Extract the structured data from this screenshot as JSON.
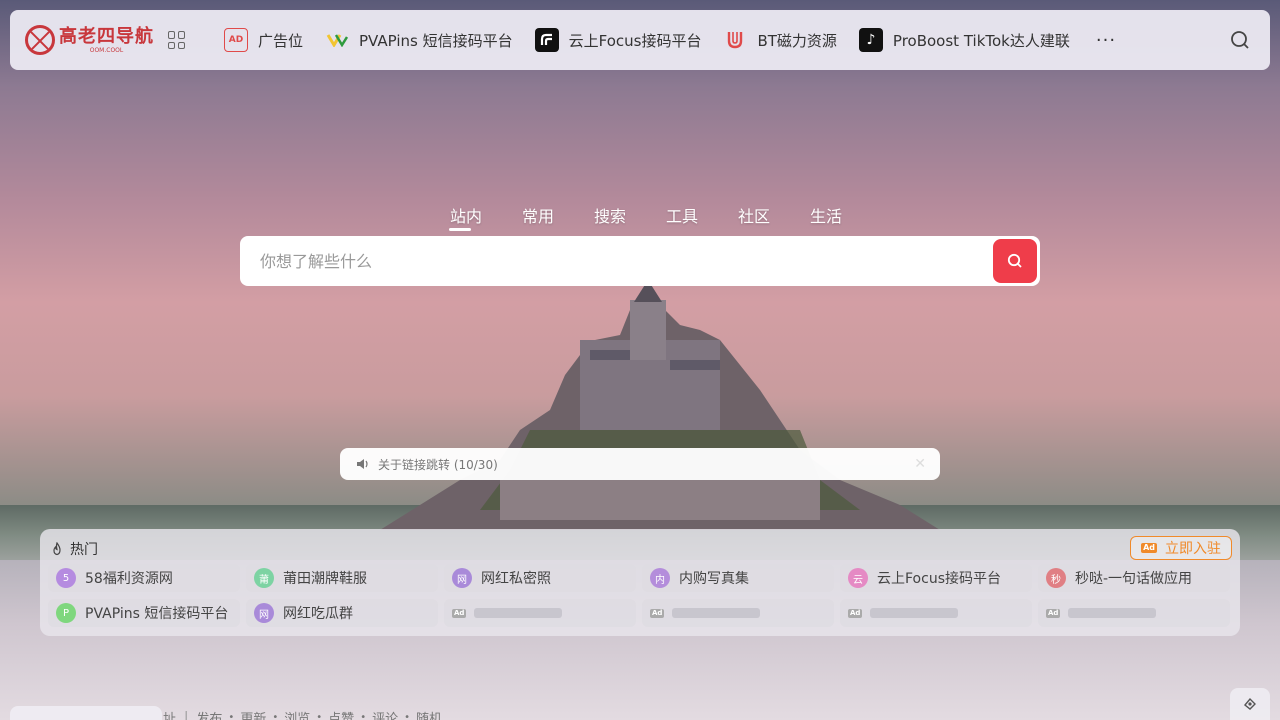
{
  "logo": {
    "title": "高老四导航",
    "subtitle": "OOM.COOL"
  },
  "nav": {
    "items": [
      {
        "label": "广告位",
        "icon": "ad-icon"
      },
      {
        "label": "PVAPins 短信接码平台",
        "icon": "pvapins-logo-icon"
      },
      {
        "label": "云上Focus接码平台",
        "icon": "focus-logo-icon"
      },
      {
        "label": "BT磁力资源",
        "icon": "magnet-icon"
      },
      {
        "label": "ProBoost TikTok达人建联",
        "icon": "tiktok-icon"
      }
    ],
    "more": "···"
  },
  "tabs": [
    "站内",
    "常用",
    "搜索",
    "工具",
    "社区",
    "生活"
  ],
  "search": {
    "placeholder": "你想了解些什么"
  },
  "notice": {
    "text": "关于链接跳转 (10/30)"
  },
  "hot": {
    "title": "热门",
    "join_label": "立即入驻",
    "items": [
      {
        "label": "58福利资源网",
        "avatar": "5",
        "color": "#b58be0"
      },
      {
        "label": "莆田潮牌鞋服",
        "avatar": "莆",
        "color": "#7dd3a3"
      },
      {
        "label": "网红私密照",
        "avatar": "网",
        "color": "#a98ad9"
      },
      {
        "label": "内购写真集",
        "avatar": "内",
        "color": "#b48ddb"
      },
      {
        "label": "云上Focus接码平台",
        "avatar": "云",
        "color": "#e58ac4"
      },
      {
        "label": "秒哒-一句话做应用",
        "avatar": "秒",
        "color": "#e07f84"
      },
      {
        "label": "PVAPins 短信接码平台",
        "avatar": "P",
        "color": "#7fd77e"
      },
      {
        "label": "网红吃瓜群",
        "avatar": "网",
        "color": "#a98ad9"
      }
    ],
    "ad_slots": 4
  },
  "footer": {
    "partial": "址",
    "links": [
      "发布",
      "更新",
      "浏览",
      "点赞",
      "评论",
      "随机"
    ]
  }
}
